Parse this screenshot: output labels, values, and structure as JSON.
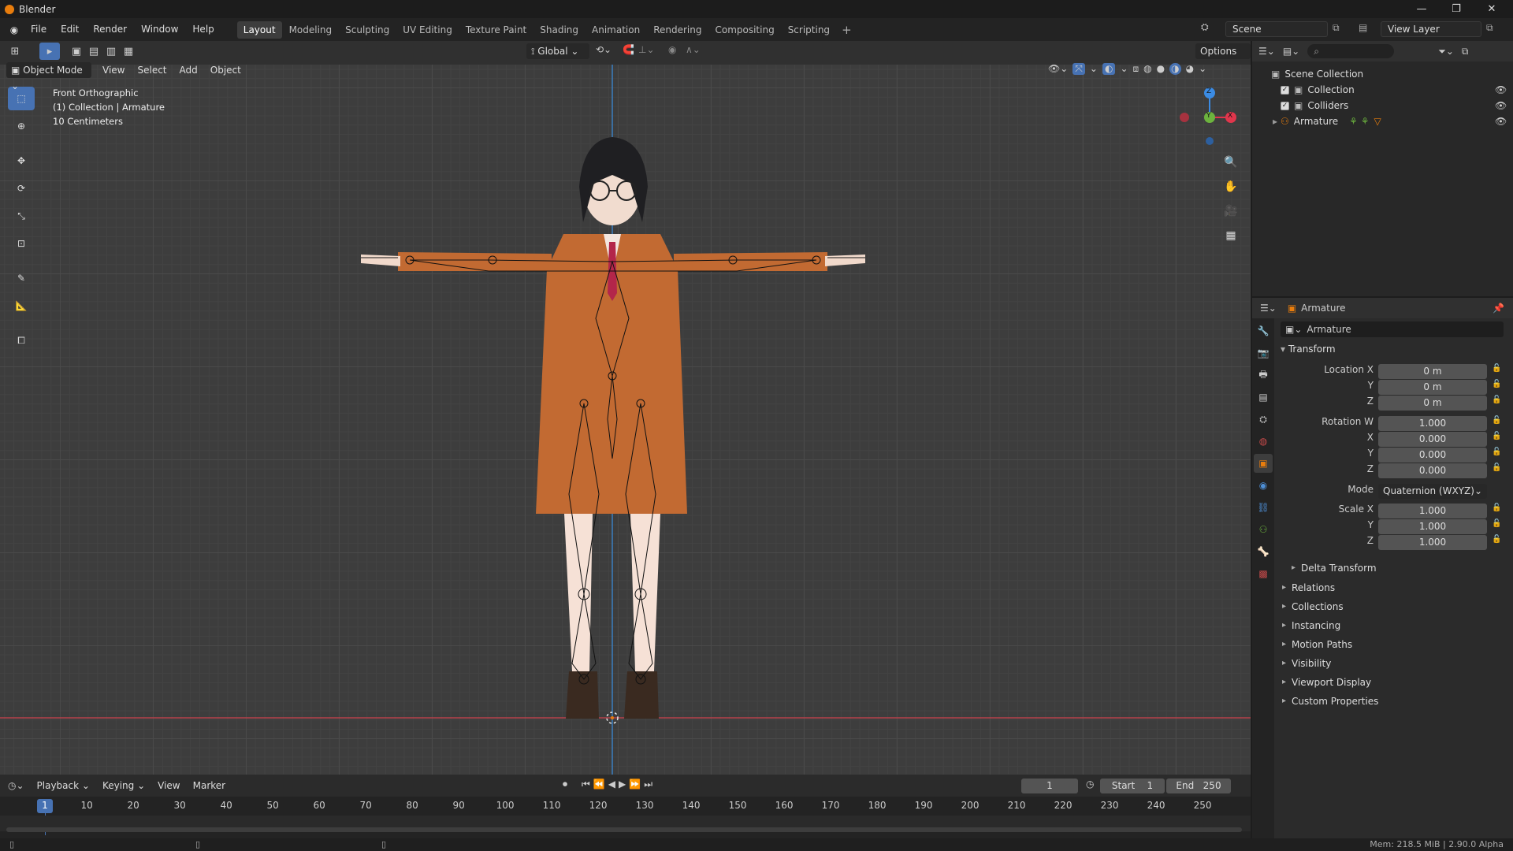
{
  "app": {
    "title": "Blender"
  },
  "menu": [
    "File",
    "Edit",
    "Render",
    "Window",
    "Help"
  ],
  "workspaces": [
    {
      "label": "Layout",
      "active": true
    },
    {
      "label": "Modeling"
    },
    {
      "label": "Sculpting"
    },
    {
      "label": "UV Editing"
    },
    {
      "label": "Texture Paint"
    },
    {
      "label": "Shading"
    },
    {
      "label": "Animation"
    },
    {
      "label": "Rendering"
    },
    {
      "label": "Compositing"
    },
    {
      "label": "Scripting"
    }
  ],
  "scene": {
    "name": "Scene",
    "view_layer": "View Layer"
  },
  "viewport": {
    "transform_orientation": "Global",
    "options_label": "Options",
    "mode": "Object Mode",
    "header_menu": [
      "View",
      "Select",
      "Add",
      "Object"
    ],
    "info": [
      "Front Orthographic",
      "(1) Collection | Armature",
      "10 Centimeters"
    ],
    "gizmo": {
      "z": "Z",
      "y": "Y",
      "x": "X"
    }
  },
  "outliner": {
    "root": "Scene Collection",
    "items": [
      {
        "label": "Collection"
      },
      {
        "label": "Colliders"
      },
      {
        "label": "Armature"
      }
    ]
  },
  "properties": {
    "object_name": "Armature",
    "datablock": "Armature",
    "transform_title": "Transform",
    "location": {
      "label": "Location X",
      "x": "0 m",
      "y": "0 m",
      "z": "0 m"
    },
    "rotation": {
      "label": "Rotation W",
      "w": "1.000",
      "x": "0.000",
      "y": "0.000",
      "z": "0.000"
    },
    "mode": {
      "label": "Mode",
      "value": "Quaternion (WXYZ)"
    },
    "scale": {
      "label": "Scale X",
      "x": "1.000",
      "y": "1.000",
      "z": "1.000"
    },
    "axis_labels": {
      "x": "X",
      "y": "Y",
      "z": "Z"
    },
    "delta": "Delta Transform",
    "panels": [
      "Relations",
      "Collections",
      "Instancing",
      "Motion Paths",
      "Visibility",
      "Viewport Display",
      "Custom Properties"
    ]
  },
  "timeline": {
    "menu": [
      "Playback",
      "Keying",
      "View",
      "Marker"
    ],
    "current_frame": "1",
    "start_label": "Start",
    "start": "1",
    "end_label": "End",
    "end": "250",
    "ticks": [
      "1",
      "10",
      "20",
      "30",
      "40",
      "50",
      "60",
      "70",
      "80",
      "90",
      "100",
      "110",
      "120",
      "130",
      "140",
      "150",
      "160",
      "170",
      "180",
      "190",
      "200",
      "210",
      "220",
      "230",
      "240",
      "250"
    ]
  },
  "status": {
    "text": "Mem: 218.5 MiB | 2.90.0 Alpha"
  },
  "colors": {
    "accent": "#4772b3",
    "x_axis": "#e0364c",
    "y_axis": "#6cb33e",
    "z_axis": "#3b8be3",
    "coat": "#c26a32",
    "orange": "#e87d0d"
  }
}
